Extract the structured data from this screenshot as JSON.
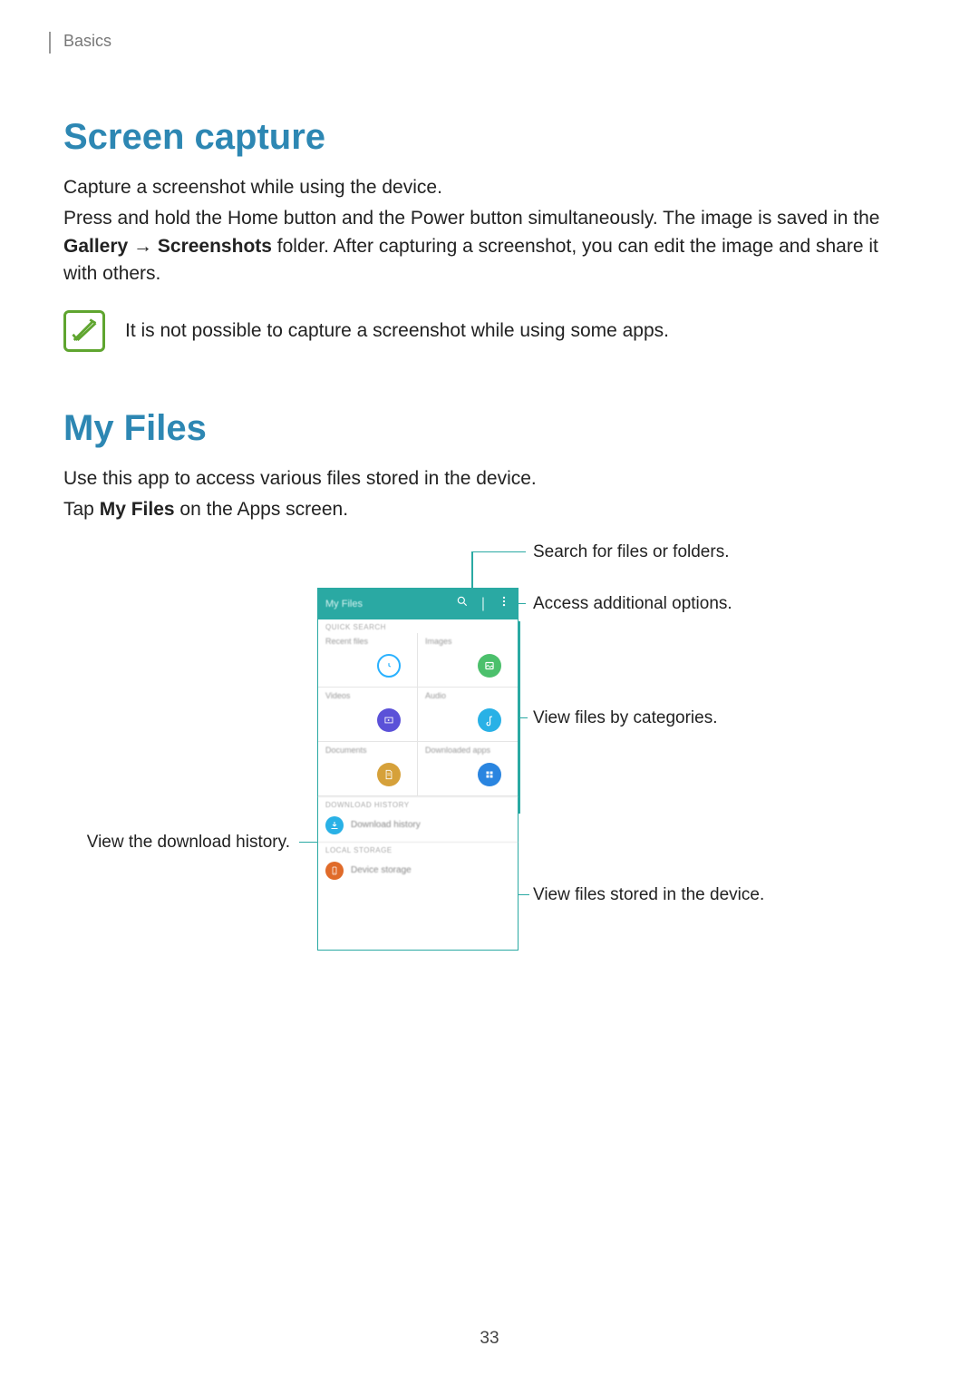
{
  "header": {
    "breadcrumb": "Basics"
  },
  "section1": {
    "title": "Screen capture",
    "p1": "Capture a screenshot while using the device.",
    "p2a": "Press and hold the Home button and the Power button simultaneously. The image is saved in the ",
    "p2b_bold": "Gallery",
    "p2c": " → ",
    "p2d_bold": "Screenshots",
    "p2e": " folder. After capturing a screenshot, you can edit the image and share it with others.",
    "note": "It is not possible to capture a screenshot while using some apps."
  },
  "section2": {
    "title": "My Files",
    "p1": "Use this app to access various files stored in the device.",
    "p2a": "Tap ",
    "p2b_bold": "My Files",
    "p2c": " on the Apps screen."
  },
  "phone": {
    "title": "My Files",
    "quick_search_label": "QUICK SEARCH",
    "categories": [
      {
        "label": "Recent files",
        "color": "#fff",
        "border": "#29b1ff",
        "icon": "clock"
      },
      {
        "label": "Images",
        "color": "#4cc06c",
        "icon": "image"
      },
      {
        "label": "Videos",
        "color": "#5b51d8",
        "icon": "video"
      },
      {
        "label": "Audio",
        "color": "#29b1e6",
        "icon": "audio"
      },
      {
        "label": "Documents",
        "color": "#d6a13a",
        "icon": "doc"
      },
      {
        "label": "Downloaded apps",
        "color": "#2a85e0",
        "icon": "apps"
      }
    ],
    "download_history_label": "DOWNLOAD HISTORY",
    "download_history_item": "Download history",
    "local_storage_label": "LOCAL STORAGE",
    "device_storage_item": "Device storage"
  },
  "callouts": {
    "search": "Search for files or folders.",
    "options": "Access additional options.",
    "categories": "View files by categories.",
    "download": "View the download history.",
    "device": "View files stored in the device."
  },
  "page_number": "33"
}
